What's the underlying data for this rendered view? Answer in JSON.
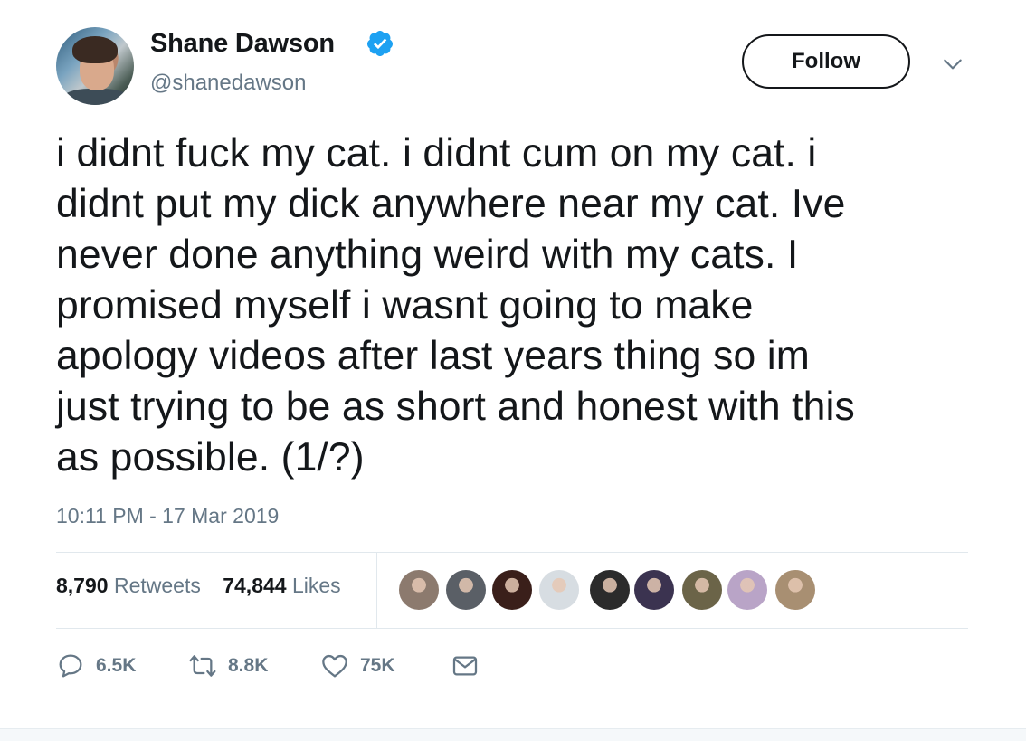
{
  "author": {
    "display_name": "Shane Dawson",
    "handle": "@shanedawson",
    "verified": true,
    "verified_color": "#1da1f2"
  },
  "follow_button": {
    "label": "Follow"
  },
  "menu": {
    "icon": "chevron-down-icon"
  },
  "tweet": {
    "text": "i didnt fuck my cat. i didnt cum on my cat. i\ndidnt put my dick anywhere near my cat. Ive\nnever done anything weird with my cats. I\npromised myself i wasnt going to make\napology videos after last years thing so im\njust trying to be as short and honest with this\nas possible. (1/?)",
    "timestamp": "10:11 PM - 17 Mar 2019"
  },
  "stats": {
    "retweets_count": "8,790",
    "retweets_label": "Retweets",
    "likes_count": "74,844",
    "likes_label": "Likes"
  },
  "likers": [
    {
      "name": "liker-avatar-1",
      "color": "#8c7a6e"
    },
    {
      "name": "liker-avatar-2",
      "color": "#5a5f66"
    },
    {
      "name": "liker-avatar-3",
      "color": "#3a1f1a"
    },
    {
      "name": "liker-avatar-4",
      "color": "#d7dde2"
    },
    {
      "name": "liker-avatar-5",
      "color": "#2b2b2b"
    },
    {
      "name": "liker-avatar-6",
      "color": "#3b3350"
    },
    {
      "name": "liker-avatar-7",
      "color": "#6b6448"
    },
    {
      "name": "liker-avatar-8",
      "color": "#b9a4c7"
    },
    {
      "name": "liker-avatar-9",
      "color": "#a88f72"
    }
  ],
  "actions": {
    "reply_count": "6.5K",
    "retweet_count": "8.8K",
    "like_count": "75K",
    "icons": [
      "reply-icon",
      "retweet-icon",
      "heart-icon",
      "dm-envelope-icon"
    ]
  },
  "colors": {
    "text": "#14171a",
    "secondary": "#657786",
    "divider": "#e1e8ed",
    "accent": "#1da1f2"
  }
}
